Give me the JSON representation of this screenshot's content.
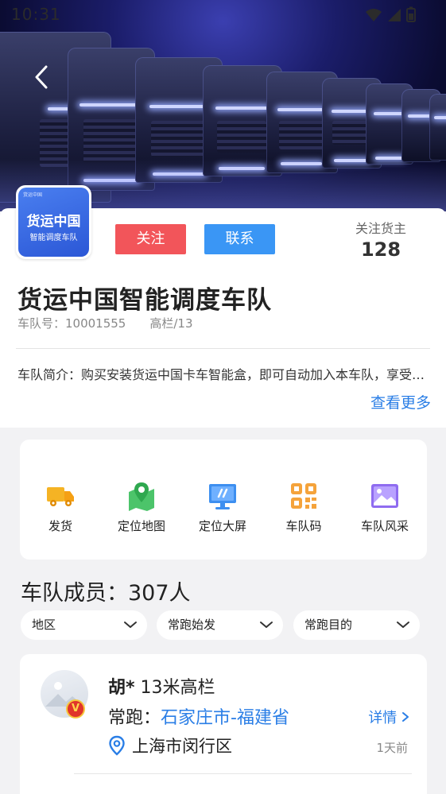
{
  "status_bar": {
    "time": "10:31"
  },
  "header": {
    "follow_label": "关注",
    "contact_label": "联系",
    "shippers_label": "关注货主",
    "shippers_count": "128"
  },
  "logo": {
    "tiny_text": "货运中国",
    "main_text": "货运中国",
    "sub_text": "智能调度车队"
  },
  "team": {
    "name": "货运中国智能调度车队",
    "id_text": "车队号：10001555",
    "vehicle_text": "高栏/13",
    "intro": "车队简介：购买安装货运中国卡车智能盒，即可自动加入本车队，享受更多运力服务与货源推荐",
    "more_label": "查看更多"
  },
  "functions": [
    {
      "label": "发货",
      "icon": "truck-icon"
    },
    {
      "label": "定位地图",
      "icon": "map-pin-icon"
    },
    {
      "label": "定位大屏",
      "icon": "monitor-icon"
    },
    {
      "label": "车队码",
      "icon": "qr-code-icon"
    },
    {
      "label": "车队风采",
      "icon": "gallery-icon"
    }
  ],
  "members": {
    "title": "车队成员：307人",
    "filters": [
      {
        "label": "地区"
      },
      {
        "label": "常跑始发"
      },
      {
        "label": "常跑目的"
      }
    ],
    "items": [
      {
        "name": "胡*",
        "vehicle": "13米高栏",
        "route_label": "常跑：",
        "route": "石家庄市-福建省",
        "detail_label": "详情",
        "location": "上海市闵行区",
        "time": "1天前",
        "badge": "V"
      }
    ]
  },
  "colors": {
    "accent_blue": "#2a7ee6",
    "follow_red": "#f2555a",
    "contact_blue": "#3a96f5"
  }
}
